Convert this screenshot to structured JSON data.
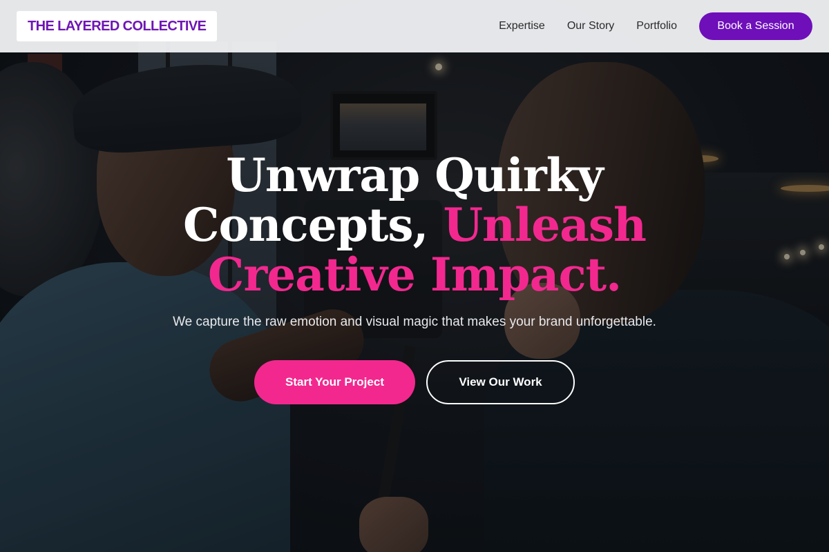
{
  "header": {
    "logo_text": "THE LAYERED COLLECTIVE",
    "nav": [
      {
        "label": "Expertise"
      },
      {
        "label": "Our Story"
      },
      {
        "label": "Portfolio"
      }
    ],
    "cta_label": "Book a Session"
  },
  "hero": {
    "headline_line1": "Unwrap Quirky",
    "headline_line2_white": "Concepts, ",
    "headline_line2_accent": "Unleash",
    "headline_line3_accent": "Creative Impact.",
    "subheadline": "We capture the raw emotion and visual magic that makes your brand unforgettable.",
    "primary_cta": "Start Your Project",
    "secondary_cta": "View Our Work",
    "background_image": "film-crew-photo"
  },
  "colors": {
    "brand_purple": "#6e0fba",
    "accent_pink": "#f2288f",
    "header_bg": "#eeeff1"
  }
}
